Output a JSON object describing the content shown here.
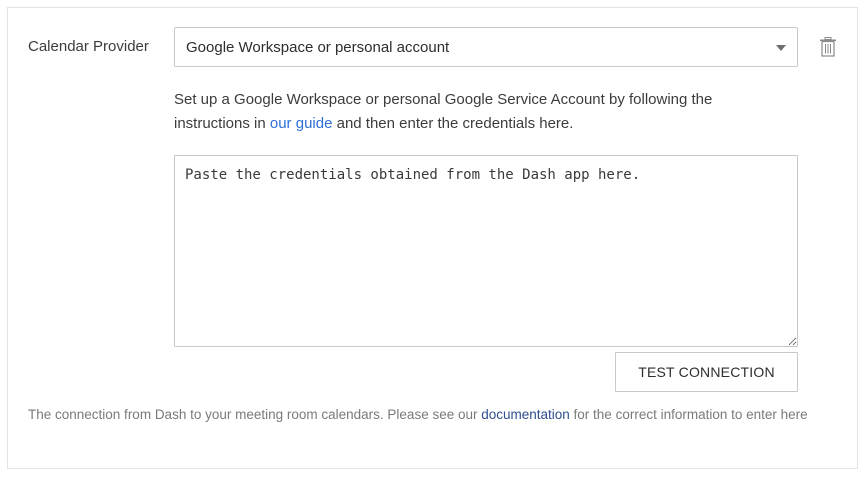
{
  "calendar": {
    "label": "Calendar Provider",
    "provider_selected": "Google Workspace or personal account"
  },
  "help": {
    "text_before": "Set up a Google Workspace or personal Google Service Account by following the instructions in ",
    "link_text": "our guide",
    "text_after": " and then enter the credentials here."
  },
  "credentials": {
    "placeholder": "Paste the credentials obtained from the Dash app here.",
    "value": ""
  },
  "actions": {
    "test_connection_label": "TEST CONNECTION"
  },
  "footer": {
    "text_before": "The connection from Dash to your meeting room calendars. Please see our ",
    "link_text": "documentation",
    "text_after": " for the correct information to enter here"
  },
  "icons": {
    "delete": "trash-icon",
    "dropdown": "caret-down-icon"
  },
  "colors": {
    "link": "#2f6fd6",
    "footer_link": "#2f4f8f",
    "border": "#c9c9c9",
    "muted_text": "#7a7a7a"
  }
}
